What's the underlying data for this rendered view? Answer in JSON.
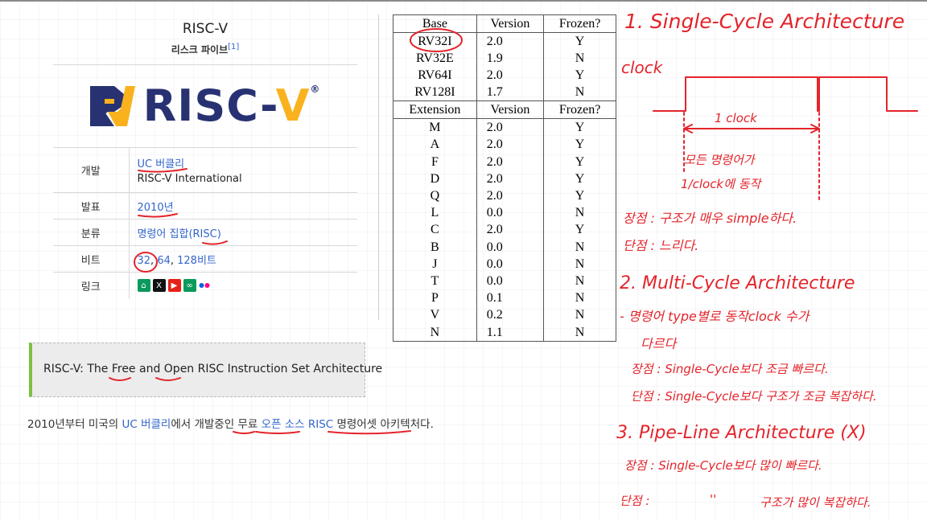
{
  "infobox": {
    "title": "RISC-V",
    "subtitle": "리스크 파이브",
    "ref": "[1]",
    "logo_text_main": "RISC-",
    "logo_text_v": "V",
    "logo_reg": "®",
    "rows": {
      "dev_key": "개발",
      "dev_val1": "UC 버클리",
      "dev_val2": "RISC-V International",
      "pub_key": "발표",
      "pub_val": "2010년",
      "cls_key": "분류",
      "cls_val_a": "명령어 집합",
      "cls_val_b": "(RISC)",
      "bit_key": "비트",
      "bit_val_a": "32",
      "bit_val_b": ", ",
      "bit_val_c": "64",
      "bit_val_d": ", ",
      "bit_val_e": "128비트",
      "link_key": "링크"
    },
    "link_icons": [
      "home-icon",
      "x-icon",
      "youtube-icon",
      "link-icon",
      "flickr-icon"
    ],
    "colors": {
      "navy": "#283272",
      "gold": "#f9b21d",
      "link": "#3366cc"
    }
  },
  "version_table": {
    "base_header": [
      "Base",
      "Version",
      "Frozen?"
    ],
    "base_rows": [
      [
        "RV32I",
        "2.0",
        "Y"
      ],
      [
        "RV32E",
        "1.9",
        "N"
      ],
      [
        "RV64I",
        "2.0",
        "Y"
      ],
      [
        "RV128I",
        "1.7",
        "N"
      ]
    ],
    "ext_header": [
      "Extension",
      "Version",
      "Frozen?"
    ],
    "ext_rows": [
      [
        "M",
        "2.0",
        "Y"
      ],
      [
        "A",
        "2.0",
        "Y"
      ],
      [
        "F",
        "2.0",
        "Y"
      ],
      [
        "D",
        "2.0",
        "Y"
      ],
      [
        "Q",
        "2.0",
        "Y"
      ],
      [
        "L",
        "0.0",
        "N"
      ],
      [
        "C",
        "2.0",
        "Y"
      ],
      [
        "B",
        "0.0",
        "N"
      ],
      [
        "J",
        "0.0",
        "N"
      ],
      [
        "T",
        "0.0",
        "N"
      ],
      [
        "P",
        "0.1",
        "N"
      ],
      [
        "V",
        "0.2",
        "N"
      ],
      [
        "N",
        "1.1",
        "N"
      ]
    ]
  },
  "quote": "RISC-V: The Free and Open RISC Instruction Set Architecture",
  "sentence": {
    "p1": "2010년부터 미국의 ",
    "p2": "UC 버클리",
    "p3": "에서 개발중인 무료 ",
    "p4": "오픈 소스",
    "p5": " ",
    "p6": "RISC",
    "p7": " 명령어셋 아키텍처다."
  },
  "notes": {
    "n1": "1. Single-Cycle Architecture",
    "clock": "clock",
    "one_clock": "1 clock",
    "all_inst_1": "모든 명령어가",
    "all_inst_2": "1/clock에 동작",
    "pro1": "장점 : 구조가 매우 simple하다.",
    "con1": "단점 : 느리다.",
    "n2": "2. Multi-Cycle Architecture",
    "n2_desc1": "- 명령어 type별로 동작clock 수가",
    "n2_desc2": "다르다",
    "pro2": "장점 : Single-Cycle보다 조금 빠르다.",
    "con2": "단점 : Single-Cycle보다 구조가 조금 복잡하다.",
    "n3": "3. Pipe-Line Architecture (X)",
    "pro3": "장점 : Single-Cycle보다 많이 빠르다.",
    "con3_a": "단점 :",
    "con3_b": "''",
    "con3_c": "구조가 많이 복잡하다.",
    "ink": "#e3242b"
  }
}
